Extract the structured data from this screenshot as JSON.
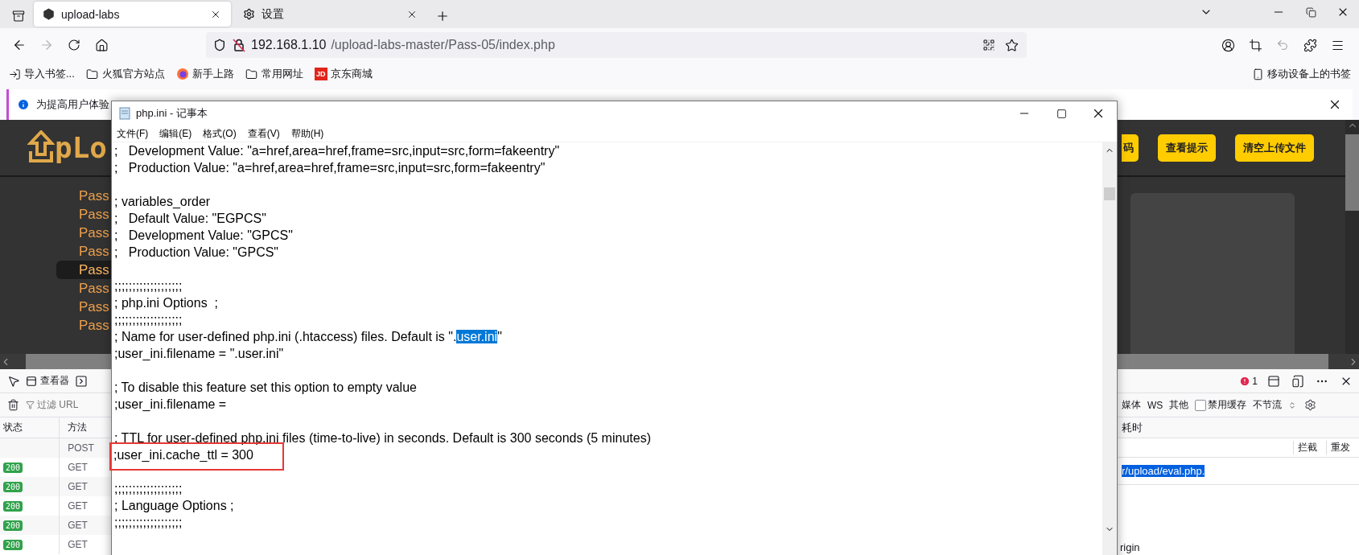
{
  "browser": {
    "tabs": [
      {
        "label": "upload-labs",
        "selected": true
      },
      {
        "label": "设置",
        "selected": false
      }
    ],
    "address": {
      "host": "192.168.1.10",
      "path": "/upload-labs-master/Pass-05/index.php"
    },
    "bookmarks": [
      {
        "label": "导入书签...",
        "kind": "import"
      },
      {
        "label": "火狐官方站点",
        "kind": "folder"
      },
      {
        "label": "新手上路",
        "kind": "firefox"
      },
      {
        "label": "常用网址",
        "kind": "folder"
      },
      {
        "label": "京东商城",
        "kind": "jd",
        "badge": "JD"
      }
    ],
    "mobile_bookmarks": "移动设备上的书签",
    "notification": "为提高用户体验"
  },
  "page": {
    "logo": "pLo",
    "header_buttons": [
      "码",
      "查看提示",
      "清空上传文件"
    ],
    "sidebar": [
      {
        "label": "Pass",
        "selected": false
      },
      {
        "label": "Pass",
        "selected": false
      },
      {
        "label": "Pass",
        "selected": false
      },
      {
        "label": "Pass",
        "selected": false
      },
      {
        "label": "Pass",
        "selected": true
      },
      {
        "label": "Pass",
        "selected": false
      },
      {
        "label": "Pass",
        "selected": false
      },
      {
        "label": "Pass",
        "selected": false
      }
    ]
  },
  "devtools": {
    "inspector_tab": "查看器",
    "filter_placeholder": "过滤 URL",
    "error_count": "1",
    "type_filters": [
      "媒体",
      "WS",
      "其他"
    ],
    "disable_cache": {
      "label": "禁用缓存",
      "checked": false
    },
    "throttle": "不节流",
    "columns": [
      "状态",
      "方法"
    ],
    "column_right": "耗时",
    "requests": [
      {
        "method": "POST"
      },
      {
        "status": "200",
        "method": "GET"
      },
      {
        "status": "200",
        "method": "GET"
      },
      {
        "status": "200",
        "method": "GET"
      },
      {
        "status": "200",
        "method": "GET"
      },
      {
        "status": "200",
        "method": "GET"
      }
    ],
    "actions": [
      "拦截",
      "重发"
    ],
    "selected_url": "r/upload/eval.php.",
    "header_fragment": "rigin"
  },
  "notepad": {
    "title": "php.ini - 记事本",
    "menu": [
      "文件(F)",
      "编辑(E)",
      "格式(O)",
      "查看(V)",
      "帮助(H)"
    ],
    "blocks": [
      [
        {
          "text": ";   Development Value: \"a=href,area=href,frame=src,input=src,form=fakeentry\"",
          "marked": false
        },
        {
          "text": ";   Production Value: \"a=href,area=href,frame=src,input=src,form=fakeentry\"",
          "marked": false
        }
      ],
      [
        {
          "text": "; variables_order",
          "marked": false
        },
        {
          "text": ";   Default Value: \"EGPCS\"",
          "marked": false
        },
        {
          "text": ";   Development Value: \"GPCS\"",
          "marked": false
        },
        {
          "text": ";   Production Value: \"GPCS\"",
          "marked": false
        }
      ],
      [
        {
          "text": ";;;;;;;;;;;;;;;;;;;",
          "marked": false
        },
        {
          "text": "; php.ini Options  ;",
          "marked": false
        },
        {
          "text": ";;;;;;;;;;;;;;;;;;;",
          "marked": false
        },
        {
          "parts": [
            {
              "text": "; Name for user-defined php.ini (.htaccess) files. Default is \".",
              "selected": false
            },
            {
              "text": "user.ini",
              "selected": true
            },
            {
              "text": "\"",
              "selected": false
            }
          ],
          "marked": false
        },
        {
          "text": ";user_ini.filename = \".user.ini\"",
          "marked": false
        }
      ],
      [
        {
          "text": "; To disable this feature set this option to empty value",
          "marked": false
        },
        {
          "text": ";user_ini.filename =",
          "marked": false
        }
      ],
      [
        {
          "text": "; TTL for user-defined php.ini files (time-to-live) in seconds. Default is 300 seconds (5 minutes)",
          "marked": false
        },
        {
          "text": ";user_ini.cache_ttl = 300",
          "marked": true
        }
      ],
      [
        {
          "text": ";;;;;;;;;;;;;;;;;;;",
          "marked": false
        },
        {
          "text": "; Language Options ;",
          "marked": false
        },
        {
          "text": ";;;;;;;;;;;;;;;;;;;",
          "marked": false
        }
      ]
    ]
  }
}
